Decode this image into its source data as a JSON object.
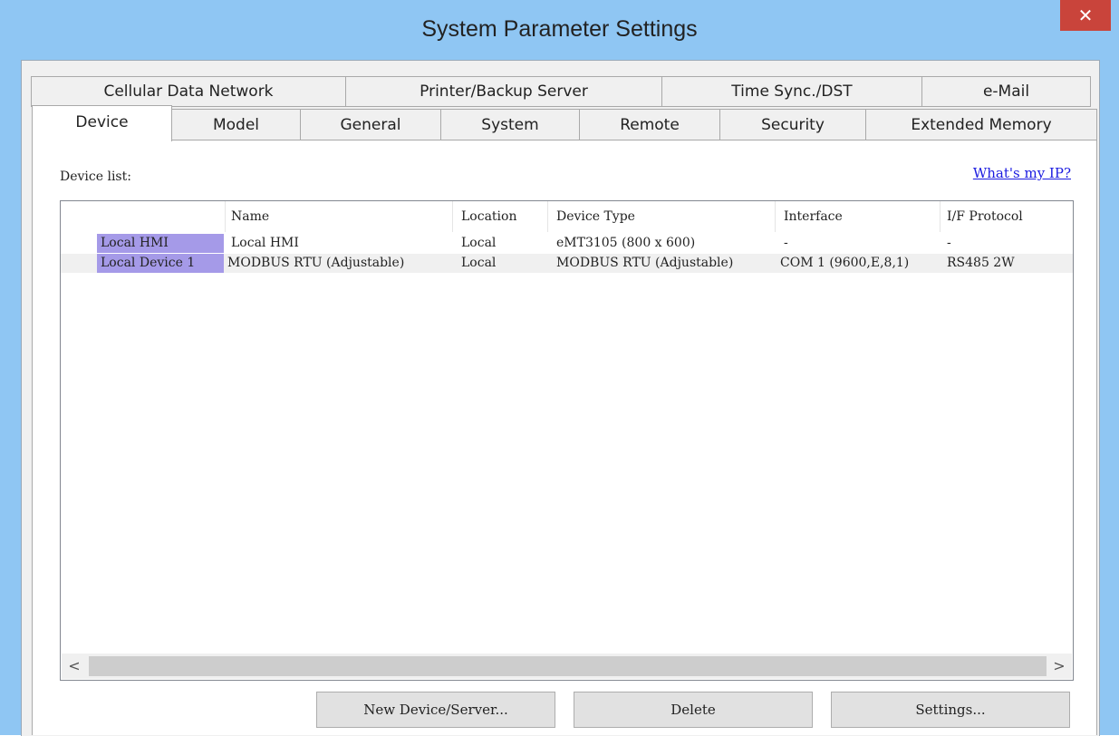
{
  "window": {
    "title": "System Parameter Settings",
    "close_glyph": "✕"
  },
  "tabs_row1": [
    "Cellular Data Network",
    "Printer/Backup Server",
    "Time Sync./DST",
    "e-Mail"
  ],
  "tabs_row2": [
    "Device",
    "Model",
    "General",
    "System",
    "Remote",
    "Security",
    "Extended Memory"
  ],
  "device_panel": {
    "label": "Device list:",
    "link": "What's my IP?"
  },
  "table": {
    "headers": [
      "Name",
      "Location",
      "Device Type",
      "Interface",
      "I/F Protocol"
    ],
    "rows": [
      {
        "label": "Local HMI",
        "name": "Local HMI",
        "location": "Local",
        "device_type": "eMT3105 (800 x 600)",
        "interface": "-",
        "protocol": "-"
      },
      {
        "label": "Local Device 1",
        "name": "MODBUS RTU (Adjustable)",
        "location": "Local",
        "device_type": "MODBUS RTU (Adjustable)",
        "interface": "COM 1 (9600,E,8,1)",
        "protocol": "RS485 2W"
      }
    ]
  },
  "scroll": {
    "left": "<",
    "right": ">"
  },
  "buttons": {
    "new": "New Device/Server...",
    "delete": "Delete",
    "settings": "Settings..."
  }
}
